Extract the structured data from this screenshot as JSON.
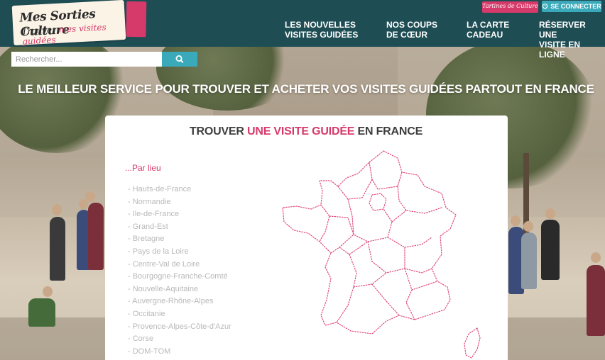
{
  "header": {
    "logo_line1": "Mes Sorties Culture",
    "logo_line2_a": "Trouver ",
    "logo_line2_b": "mes",
    "logo_line2_c": " visites guidées",
    "nav": [
      {
        "line1": "LES NOUVELLES",
        "line2": "VISITES GUIDÉES"
      },
      {
        "line1": "NOS COUPS",
        "line2": "DE CŒUR"
      },
      {
        "line1": "LA CARTE",
        "line2": "CADEAU"
      },
      {
        "line1": "RÉSERVER UNE",
        "line2": "VISITE EN LIGNE"
      }
    ],
    "tartines_label": "Tartines de Culture",
    "connect_label": "SE CONNECTER",
    "connect_icon": "power-icon"
  },
  "search": {
    "placeholder": "Rechercher...",
    "icon": "search-icon"
  },
  "tagline": "LE MEILLEUR SERVICE POUR TROUVER ET ACHETER VOS VISITES GUIDÉES PARTOUT EN FRANCE",
  "finder": {
    "title_a": "TROUVER ",
    "title_b": "UNE VISITE GUIDÉE",
    "title_c": " EN FRANCE",
    "by_place": "...Par lieu",
    "regions": [
      "- Hauts-de-France",
      "- Normandie",
      "- Ile-de-France",
      "- Grand-Est",
      "- Bretagne",
      "- Pays de la Loire",
      "- Centre-Val de Loire",
      "- Bourgogne-Franche-Comté",
      "- Nouvelle-Aquitaine",
      "- Auvergne-Rhône-Alpes",
      "- Occitanie",
      "- Provence-Alpes-Côte-d'Azur",
      "- Corse",
      "- DOM-TOM"
    ]
  },
  "colors": {
    "header_bg": "#1f4d54",
    "accent_pink": "#d63a6a",
    "accent_teal": "#3aa9b9"
  }
}
